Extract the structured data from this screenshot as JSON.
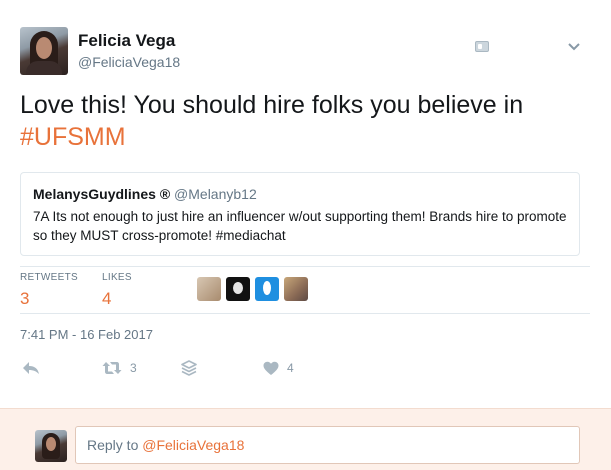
{
  "author": {
    "display_name": "Felicia Vega",
    "screen_name": "@FeliciaVega18"
  },
  "tweet": {
    "text_plain": "Love this! You should hire folks you believe in",
    "hashtag": "#UFSMM"
  },
  "quoted_tweet": {
    "display_name": "MelanysGuydlines ®",
    "screen_name": "@Melanyb12",
    "text": "7A Its not enough to just hire an influencer w/out supporting them! Brands hire to promote so they MUST cross-promote! #mediachat"
  },
  "stats": {
    "retweets_label": "RETWEETS",
    "retweets_count": "3",
    "likes_label": "LIKES",
    "likes_count": "4"
  },
  "timestamp": "7:41 PM - 16 Feb 2017",
  "actions": {
    "retweet_count": "3",
    "like_count": "4"
  },
  "reply": {
    "prefix": "Reply to ",
    "mention": "@FeliciaVega18"
  },
  "icons": {
    "reply": "reply-icon",
    "retweet": "retweet-icon",
    "save": "layers-icon",
    "like": "heart-icon",
    "menu": "chevron-down-icon",
    "follow": "follow-icon"
  },
  "colors": {
    "accent": "#e8723a",
    "muted": "#657786",
    "icon": "#aab8c2",
    "reply_bg": "#fdf0e9"
  }
}
